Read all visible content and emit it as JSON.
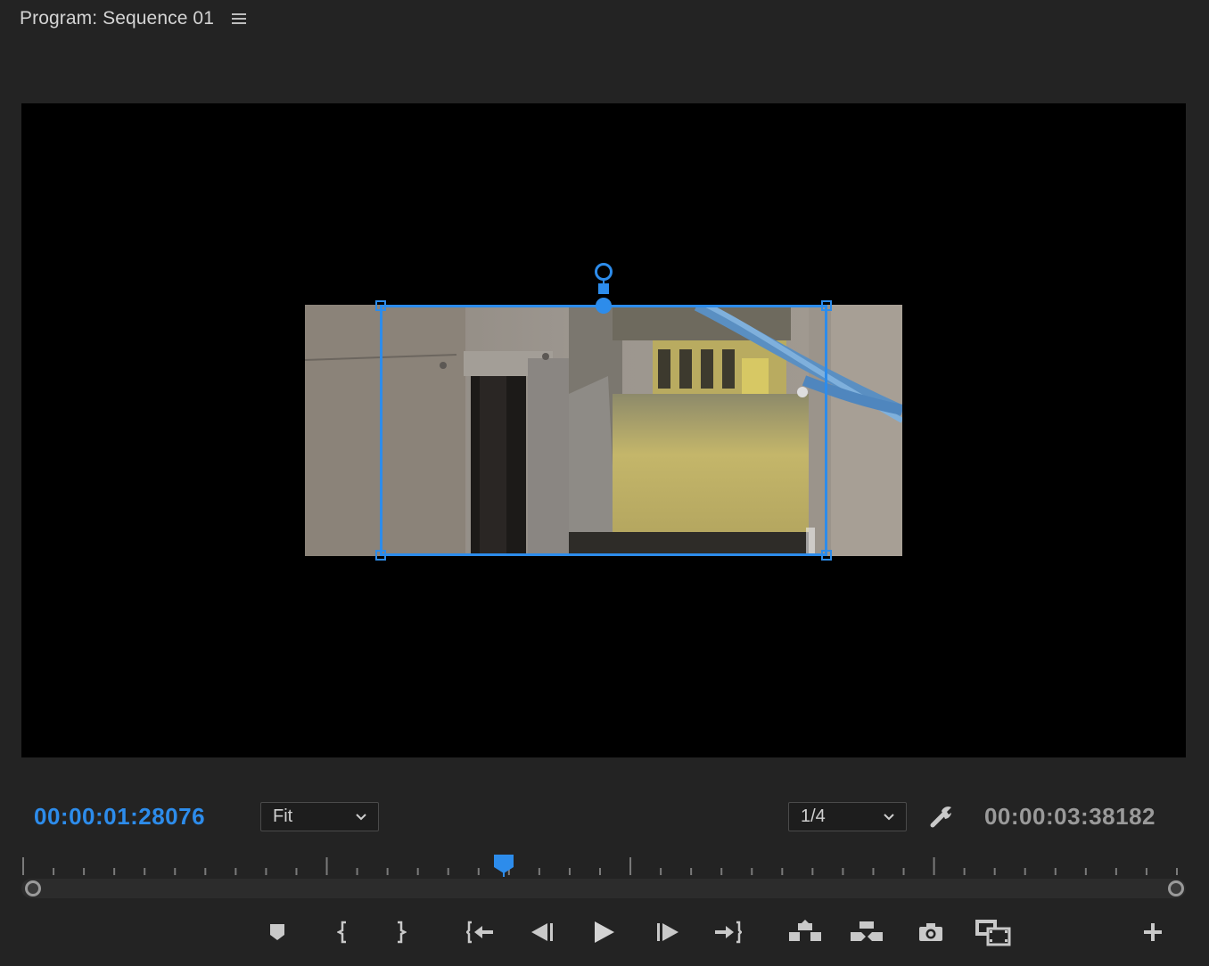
{
  "panel": {
    "title": "Program: Sequence 01",
    "menu_icon": "hamburger-menu-icon"
  },
  "viewer": {
    "background": "#000000",
    "selection_color": "#2d8ceb"
  },
  "controls": {
    "current_timecode": "00:00:01:28076",
    "duration_timecode": "00:00:03:38182",
    "zoom_value": "Fit",
    "resolution_value": "1/4",
    "settings_icon": "wrench-icon"
  },
  "transport": {
    "buttons": [
      {
        "name": "add-marker-button",
        "icon": "marker-icon"
      },
      {
        "name": "mark-in-button",
        "icon": "mark-in-icon"
      },
      {
        "name": "mark-out-button",
        "icon": "mark-out-icon"
      },
      {
        "name": "go-to-in-button",
        "icon": "go-to-in-icon"
      },
      {
        "name": "step-back-button",
        "icon": "step-back-icon"
      },
      {
        "name": "play-button",
        "icon": "play-icon"
      },
      {
        "name": "step-forward-button",
        "icon": "step-forward-icon"
      },
      {
        "name": "go-to-out-button",
        "icon": "go-to-out-icon"
      },
      {
        "name": "lift-button",
        "icon": "lift-icon"
      },
      {
        "name": "extract-button",
        "icon": "extract-icon"
      },
      {
        "name": "export-frame-button",
        "icon": "camera-icon"
      },
      {
        "name": "comparison-view-button",
        "icon": "comparison-view-icon"
      },
      {
        "name": "button-editor-button",
        "icon": "plus-icon"
      }
    ]
  },
  "colors": {
    "accent": "#2d8ceb",
    "panel_bg": "#232323",
    "text": "#d4d4d4",
    "muted": "#9a9a9a"
  }
}
